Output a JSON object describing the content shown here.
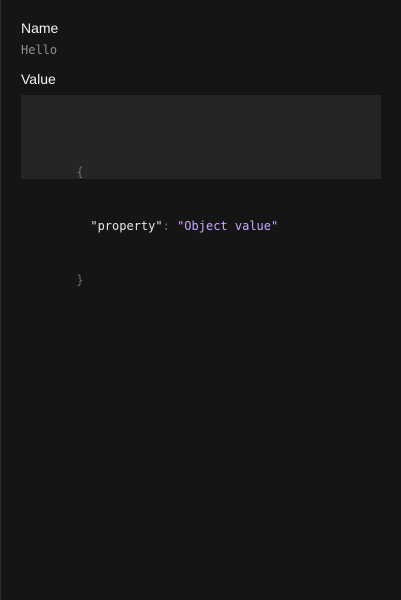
{
  "fields": {
    "name_label": "Name",
    "name_value": "Hello",
    "value_label": "Value"
  },
  "json": {
    "open_brace": "{",
    "close_brace": "}",
    "key": "\"property\"",
    "separator": ":",
    "string_value": "\"Object value\""
  },
  "colors": {
    "background": "#151515",
    "panel": "#252525",
    "label": "#f2f2f2",
    "muted": "#8f8f8f",
    "string": "#c7a4ff"
  }
}
